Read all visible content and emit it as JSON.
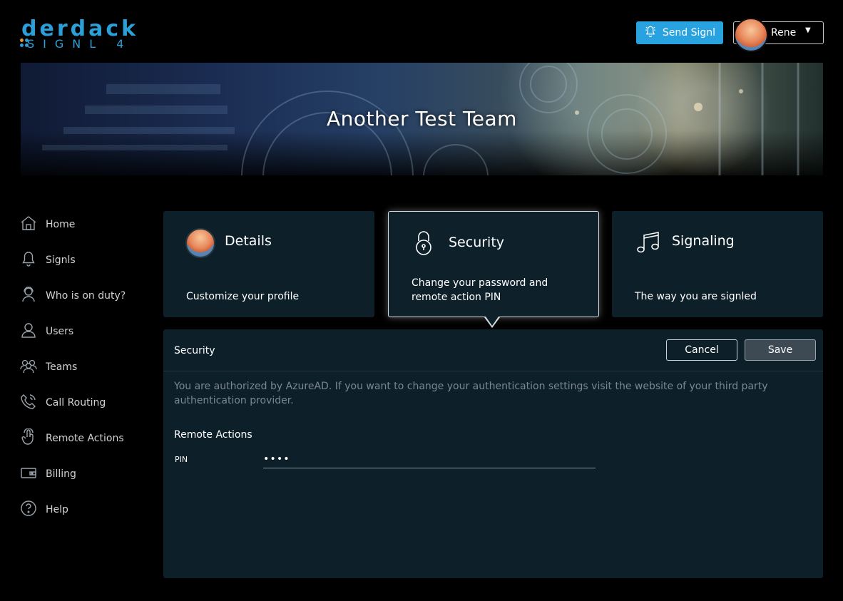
{
  "brand": {
    "logo_word": "DerDack",
    "logo_sub": "SIGNL 4",
    "accent_color": "#29a3e0"
  },
  "header": {
    "send_button_label": "Send Signl",
    "user_name": "Rene"
  },
  "banner": {
    "team_name": "Another Test Team"
  },
  "sidebar": {
    "items": [
      {
        "label": "Home",
        "icon": "home-icon"
      },
      {
        "label": "Signls",
        "icon": "bell-icon"
      },
      {
        "label": "Who is on duty?",
        "icon": "person-headset-icon"
      },
      {
        "label": "Users",
        "icon": "user-icon"
      },
      {
        "label": "Teams",
        "icon": "team-icon"
      },
      {
        "label": "Call Routing",
        "icon": "phone-icon"
      },
      {
        "label": "Remote Actions",
        "icon": "touch-icon"
      },
      {
        "label": "Billing",
        "icon": "wallet-icon"
      },
      {
        "label": "Help",
        "icon": "question-icon"
      }
    ]
  },
  "cards": [
    {
      "title": "Details",
      "description": "Customize your profile",
      "icon": "avatar-icon"
    },
    {
      "title": "Security",
      "description": "Change your password and remote action PIN",
      "icon": "lock-icon"
    },
    {
      "title": "Signaling",
      "description": "The way you are signled",
      "icon": "music-note-icon"
    }
  ],
  "panel": {
    "title": "Security",
    "cancel_label": "Cancel",
    "save_label": "Save",
    "auth_message": "You are authorized by AzureAD. If you want to change your authentication settings visit the website of your third party authentication provider.",
    "remote_actions_title": "Remote Actions",
    "pin_label": "PIN",
    "pin_value": "••••"
  }
}
